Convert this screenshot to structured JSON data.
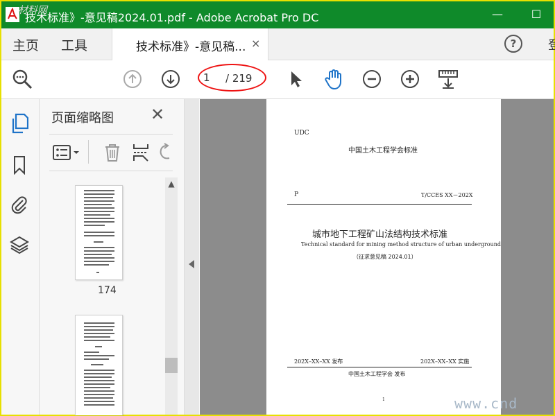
{
  "window": {
    "title": "技术标准》-意见稿2024.01.pdf - Adobe Acrobat Pro DC",
    "corner_mark": "材料网",
    "minimize_glyph": "—",
    "maximize_glyph": "☐"
  },
  "tabs": {
    "home": "主页",
    "tools": "工具",
    "document": "技术标准》-意见稿...",
    "close_glyph": "×",
    "help_glyph": "?",
    "overflow": "登"
  },
  "toolbar": {
    "page_value": "1",
    "page_total": "/ 219",
    "icons": [
      "search-zoom-icon",
      "prev-page-icon",
      "next-page-icon",
      "select-pointer-icon",
      "hand-tool-icon",
      "zoom-out-icon",
      "zoom-in-icon",
      "fit-page-icon"
    ]
  },
  "panel": {
    "title": "页面缩略图",
    "close_glyph": "✕",
    "thumbnails": [
      {
        "label": "174"
      },
      {
        "label": ""
      }
    ]
  },
  "document_page": {
    "udc": "UDC",
    "society_standard": "中国土木工程学会标准",
    "p": "P",
    "code": "T/CCES XX－202X",
    "title_cn": "城市地下工程矿山法结构技术标准",
    "title_en": "Technical standard for mining method structure of urban underground",
    "draft": "（征求意见稿 2024.01）",
    "publish_date": "202X–XX–XX  发布",
    "implement_date": "202X–XX–XX  实施",
    "publisher": "中国土木工程学会      发布",
    "page_marker": "1"
  },
  "watermark": "www.cnd",
  "colors": {
    "titlebar": "#0f8a2a",
    "border": "#e7e000",
    "annotation": "#e11111",
    "hand_tool": "#1e73c8"
  }
}
